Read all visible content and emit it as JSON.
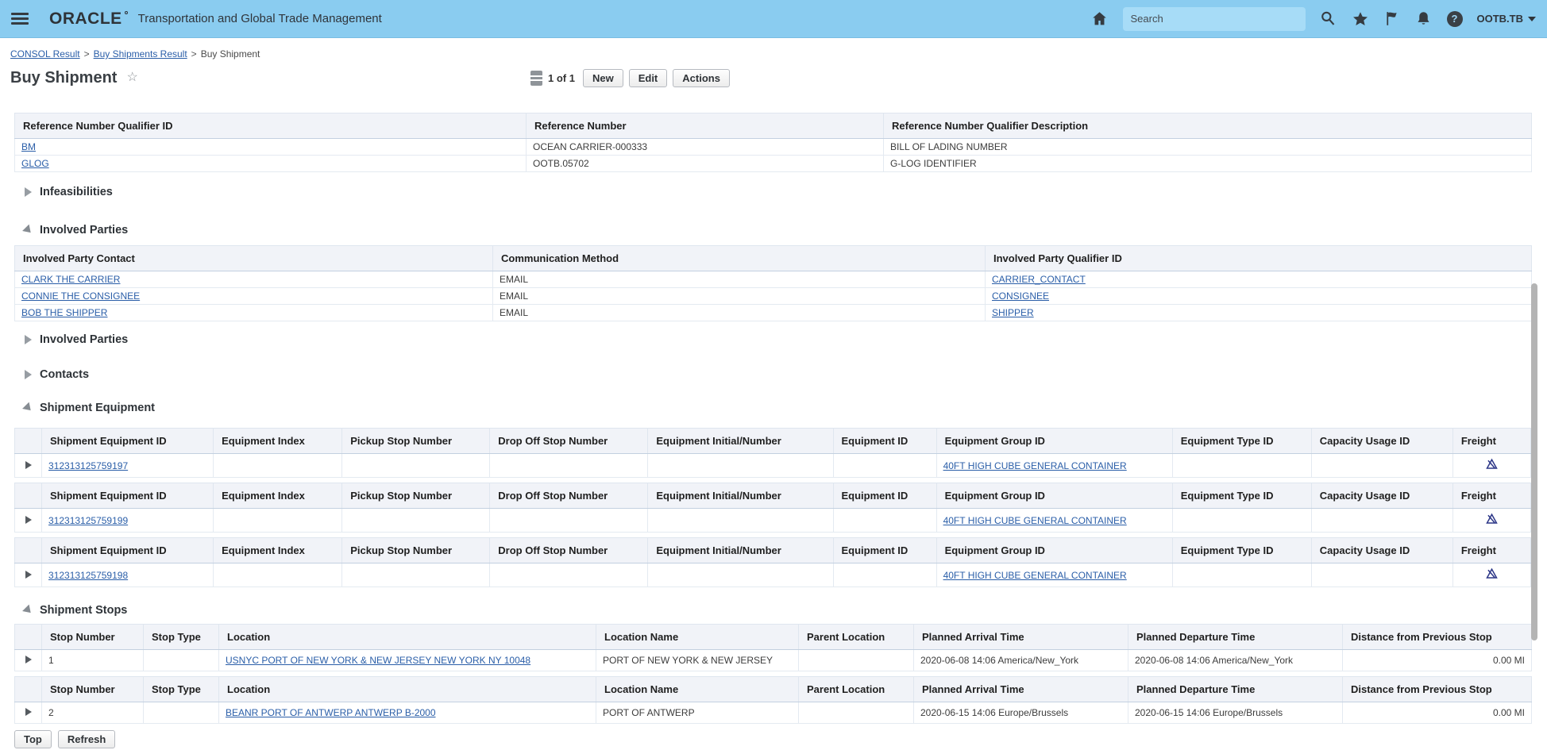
{
  "topbar": {
    "brand": "ORACLE",
    "title": "Transportation and Global Trade Management",
    "search_placeholder": "Search",
    "user": "OOTB.TB"
  },
  "icons": {
    "menu": "hamburger",
    "home": "house",
    "search": "magnifier",
    "favorites": "star",
    "flag": "flag",
    "notifications": "bell",
    "help": "?",
    "user_caret": "caret-down",
    "title_favorite": "☆",
    "pagination": "list",
    "section_collapsed": "triangle-right",
    "section_expanded": "triangle-open",
    "row_disclosure": "triangle-right",
    "freight": "freight-triangle"
  },
  "colors": {
    "topbar_bg": "#8accf0",
    "search_bg": "#a7dcf7",
    "link": "#2a5ea8",
    "header_bg": "#f1f3f8",
    "border_outer": "#c3d0e0",
    "freight": "#2c3687"
  },
  "breadcrumb": {
    "separator": ">",
    "items": [
      {
        "label": "CONSOL Result",
        "link": true
      },
      {
        "label": "Buy Shipments Result",
        "link": true
      },
      {
        "label": "Buy Shipment",
        "link": false
      }
    ]
  },
  "page": {
    "title": "Buy Shipment",
    "pagination": "1 of 1",
    "new": "New",
    "edit": "Edit",
    "actions": "Actions",
    "top": "Top",
    "refresh": "Refresh"
  },
  "sections": {
    "infeasibilities": "Infeasibilities",
    "involved_parties": "Involved Parties",
    "involved_parties2": "Involved Parties",
    "contacts": "Contacts",
    "shipment_equipment": "Shipment Equipment",
    "shipment_stops": "Shipment Stops"
  },
  "reference_table": {
    "headers": [
      "Reference Number Qualifier ID",
      "Reference Number",
      "Reference Number Qualifier Description"
    ],
    "rows": [
      {
        "qualifier": "BM",
        "number": "OCEAN CARRIER-000333",
        "description": "BILL OF LADING NUMBER"
      },
      {
        "qualifier": "GLOG",
        "number": "OOTB.05702",
        "description": "G-LOG IDENTIFIER"
      }
    ]
  },
  "ip_table": {
    "headers": [
      "Involved Party Contact",
      "Communication Method",
      "Involved Party Qualifier ID"
    ],
    "rows": [
      {
        "contact": "CLARK THE CARRIER",
        "method": "EMAIL",
        "qualifier": "CARRIER_CONTACT"
      },
      {
        "contact": "CONNIE THE CONSIGNEE",
        "method": "EMAIL",
        "qualifier": "CONSIGNEE"
      },
      {
        "contact": "BOB THE SHIPPER",
        "method": "EMAIL",
        "qualifier": "SHIPPER"
      }
    ]
  },
  "equipment": {
    "headers": [
      "Shipment Equipment ID",
      "Equipment Index",
      "Pickup Stop Number",
      "Drop Off Stop Number",
      "Equipment Initial/Number",
      "Equipment ID",
      "Equipment Group ID",
      "Equipment Type ID",
      "Capacity Usage ID",
      "Freight"
    ],
    "rows": [
      {
        "id": "312313125759197",
        "group": "40FT HIGH CUBE GENERAL CONTAINER"
      },
      {
        "id": "312313125759199",
        "group": "40FT HIGH CUBE GENERAL CONTAINER"
      },
      {
        "id": "312313125759198",
        "group": "40FT HIGH CUBE GENERAL CONTAINER"
      }
    ]
  },
  "stops": {
    "headers": [
      "Stop Number",
      "Stop Type",
      "Location",
      "Location Name",
      "Parent Location",
      "Planned Arrival Time",
      "Planned Departure Time",
      "Distance from Previous Stop"
    ],
    "rows": [
      {
        "number": "1",
        "location": "USNYC PORT OF NEW YORK & NEW JERSEY NEW YORK NY 10048",
        "name": "PORT OF NEW YORK & NEW JERSEY",
        "arrival": "2020-06-08 14:06 America/New_York",
        "departure": "2020-06-08 14:06 America/New_York",
        "distance": "0.00 MI"
      },
      {
        "number": "2",
        "location": "BEANR PORT OF ANTWERP ANTWERP B-2000",
        "name": "PORT OF ANTWERP",
        "arrival": "2020-06-15 14:06 Europe/Brussels",
        "departure": "2020-06-15 14:06 Europe/Brussels",
        "distance": "0.00 MI"
      }
    ]
  }
}
